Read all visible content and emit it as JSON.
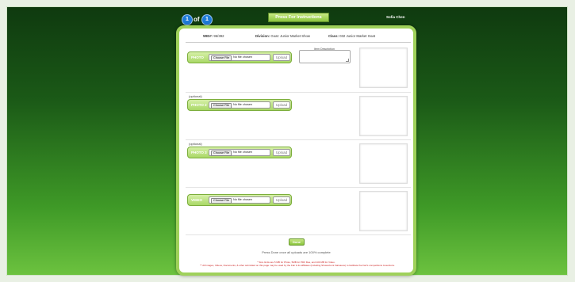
{
  "nav": {
    "current_page": "1",
    "of_label": "of",
    "total_pages": "1",
    "instructions_button": "Press For Instructions",
    "user_name": "Sofia Chen"
  },
  "entry": {
    "wid_label": "WID#:",
    "wid_value": "96/392",
    "division_label": "Division:",
    "division_value": "Goat: Junior Market Show",
    "class_label": "Class:",
    "class_value": "032 Junior Market Goat"
  },
  "uploads": [
    {
      "label": "PHOTO",
      "optional_label": "",
      "choose_label": "Choose File",
      "file_status": "No file chosen",
      "upload_label": "Upload"
    },
    {
      "label": "PHOTO 2",
      "optional_label": "(optional)",
      "choose_label": "Choose File",
      "file_status": "No file chosen",
      "upload_label": "Upload"
    },
    {
      "label": "PHOTO 3",
      "optional_label": "(optional)",
      "choose_label": "Choose File",
      "file_status": "No file chosen",
      "upload_label": "Upload"
    },
    {
      "label": "VIDEO",
      "optional_label": "",
      "choose_label": "Choose File",
      "file_status": "No file chosen",
      "upload_label": "Upload"
    }
  ],
  "description": {
    "label": "Item Description",
    "value": ""
  },
  "footer": {
    "done_button": "Done",
    "done_note": "Press Done once all uploads are 100% complete",
    "size_note": "* Size limits are 5 MB for Photo, 5MB for PDF files, and 100 MB for Video.",
    "legal_note": "** All Images, Videos, Documents, & other submitted on this page may be used by the Fair & its affiliates (including Showorks & Fairsauce) to facilitate the Fair's competitions & auctions."
  },
  "colors": {
    "accent_green": "#8cc63f",
    "card_border": "#9fd15a",
    "badge_blue": "#1e7bd8",
    "note_red": "#cc2222"
  }
}
